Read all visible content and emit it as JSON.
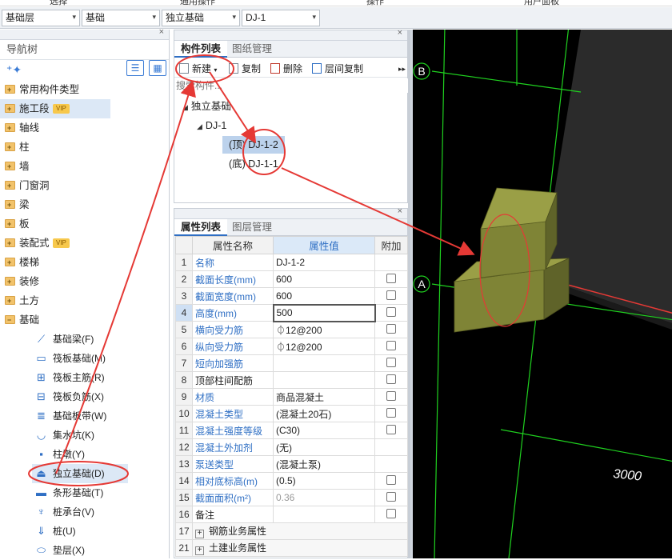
{
  "menu": [
    "选择",
    "通用操作",
    "操作",
    "用户面板"
  ],
  "selectors": [
    {
      "value": "基础层"
    },
    {
      "value": "基础"
    },
    {
      "value": "独立基础"
    },
    {
      "value": "DJ-1"
    }
  ],
  "nav": {
    "title": "导航树",
    "items": [
      {
        "label": "常用构件类型"
      },
      {
        "label": "施工段",
        "badge": "VIP"
      },
      {
        "label": "轴线"
      },
      {
        "label": "柱"
      },
      {
        "label": "墙"
      },
      {
        "label": "门窗洞"
      },
      {
        "label": "梁"
      },
      {
        "label": "板"
      },
      {
        "label": "装配式",
        "badge": "VIP"
      },
      {
        "label": "楼梯"
      },
      {
        "label": "装修"
      },
      {
        "label": "土方"
      },
      {
        "label": "基础"
      }
    ],
    "sub_items": [
      {
        "label": "基础梁(F)",
        "icon": "beam-icon"
      },
      {
        "label": "筏板基础(M)",
        "icon": "raft-icon"
      },
      {
        "label": "筏板主筋(R)",
        "icon": "rebar-main-icon"
      },
      {
        "label": "筏板负筋(X)",
        "icon": "rebar-neg-icon"
      },
      {
        "label": "基础板带(W)",
        "icon": "strip-icon"
      },
      {
        "label": "集水坑(K)",
        "icon": "sump-icon"
      },
      {
        "label": "柱墩(Y)",
        "icon": "pier-icon"
      },
      {
        "label": "独立基础(D)",
        "icon": "footing-icon"
      },
      {
        "label": "条形基础(T)",
        "icon": "strip-footing-icon"
      },
      {
        "label": "桩承台(V)",
        "icon": "pile-cap-icon"
      },
      {
        "label": "桩(U)",
        "icon": "pile-icon"
      },
      {
        "label": "垫层(X)",
        "icon": "cushion-icon"
      }
    ]
  },
  "component_panel": {
    "tabs": [
      "构件列表",
      "图纸管理"
    ],
    "toolbar": {
      "new": "新建",
      "copy": "复制",
      "delete": "删除",
      "floor_copy": "层间复制"
    },
    "search_placeholder": "搜索构件...",
    "tree": {
      "root": "独立基础",
      "child": "DJ-1",
      "leaves": [
        "(顶) DJ-1-2",
        "(底) DJ-1-1"
      ]
    }
  },
  "property_panel": {
    "tabs": [
      "属性列表",
      "图层管理"
    ],
    "headers": {
      "name": "属性名称",
      "value": "属性值",
      "extra": "附加"
    },
    "rows": [
      {
        "no": "1",
        "name": "名称",
        "value": "DJ-1-2",
        "blue": true,
        "check": false
      },
      {
        "no": "2",
        "name": "截面长度(mm)",
        "value": "600",
        "blue": true,
        "check": true
      },
      {
        "no": "3",
        "name": "截面宽度(mm)",
        "value": "600",
        "blue": true,
        "check": true
      },
      {
        "no": "4",
        "name": "高度(mm)",
        "value": "500",
        "blue": true,
        "check": true
      },
      {
        "no": "5",
        "name": "横向受力筋",
        "value": "⏀12@200",
        "blue": true,
        "check": true
      },
      {
        "no": "6",
        "name": "纵向受力筋",
        "value": "⏀12@200",
        "blue": true,
        "check": true
      },
      {
        "no": "7",
        "name": "短向加强筋",
        "value": "",
        "blue": true,
        "check": true
      },
      {
        "no": "8",
        "name": "顶部柱间配筋",
        "value": "",
        "blue": false,
        "check": true
      },
      {
        "no": "9",
        "name": "材质",
        "value": "商品混凝土",
        "blue": true,
        "check": true
      },
      {
        "no": "10",
        "name": "混凝土类型",
        "value": "(混凝土20石)",
        "blue": true,
        "check": true
      },
      {
        "no": "11",
        "name": "混凝土强度等级",
        "value": "(C30)",
        "blue": true,
        "check": true
      },
      {
        "no": "12",
        "name": "混凝土外加剂",
        "value": "(无)",
        "blue": true,
        "check": false
      },
      {
        "no": "13",
        "name": "泵送类型",
        "value": "(混凝土泵)",
        "blue": true,
        "check": false
      },
      {
        "no": "14",
        "name": "相对底标高(m)",
        "value": "(0.5)",
        "blue": true,
        "check": true
      },
      {
        "no": "15",
        "name": "截面面积(m²)",
        "value": "0.36",
        "blue": true,
        "gray": true,
        "check": true
      },
      {
        "no": "16",
        "name": "备注",
        "value": "",
        "blue": false,
        "check": true
      }
    ],
    "groups": [
      {
        "no": "17",
        "name": "钢筋业务属性"
      },
      {
        "no": "21",
        "name": "土建业务属性"
      }
    ]
  },
  "viewport": {
    "axis_labels": [
      "B",
      "A"
    ],
    "dimension": "3000"
  },
  "colors": {
    "accent": "#2f6fc4",
    "annotation": "#e53935",
    "grid": "#1fd11f",
    "footing": "#7f8436",
    "background3d": "#000000"
  }
}
